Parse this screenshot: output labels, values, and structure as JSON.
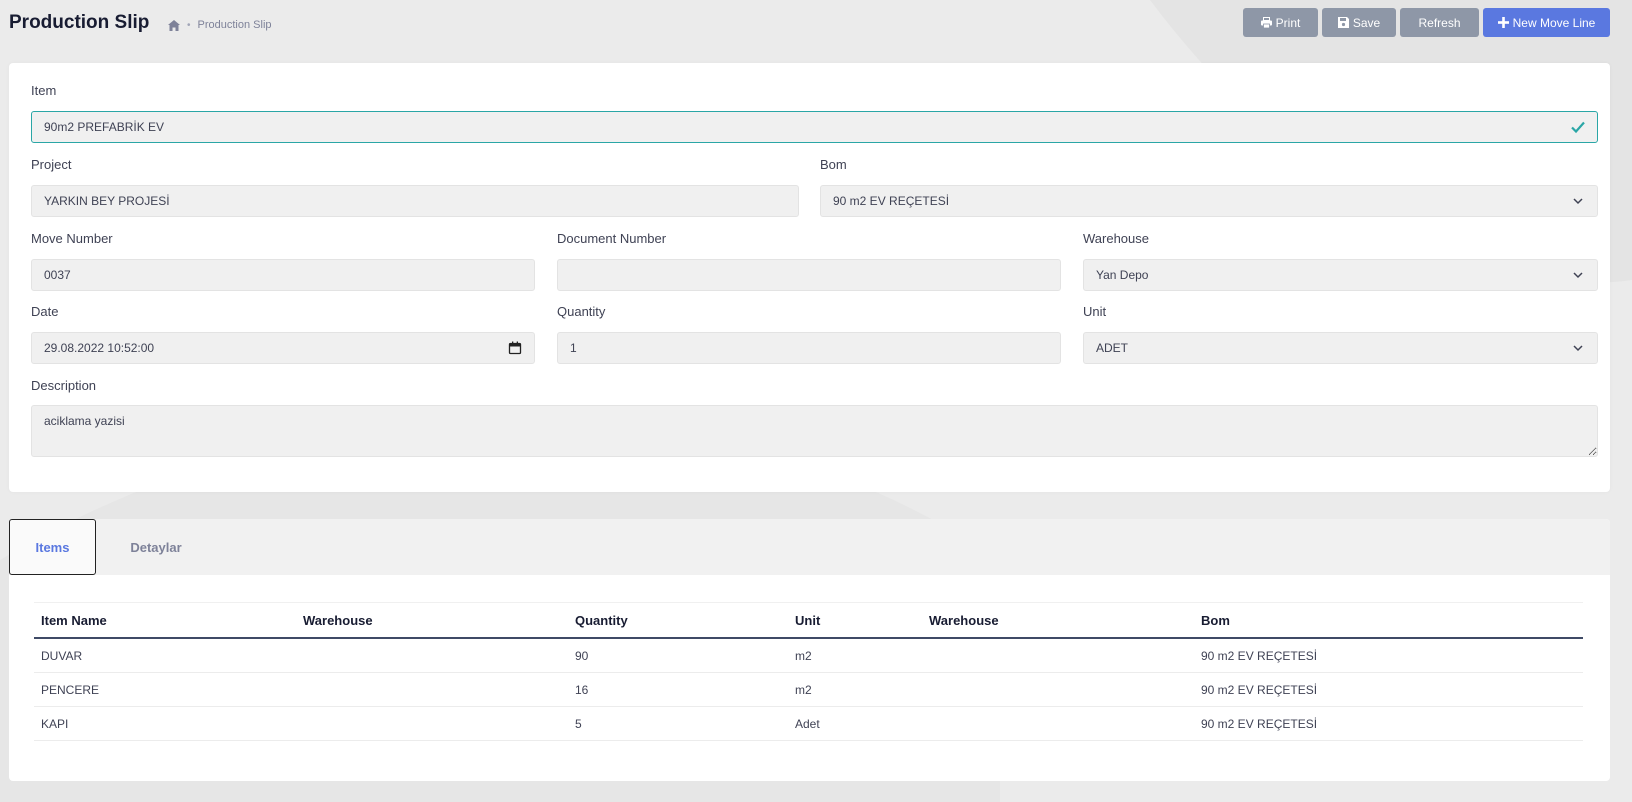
{
  "header": {
    "title": "Production Slip",
    "breadcrumb_current": "Production Slip",
    "buttons": {
      "print": "Print",
      "save": "Save",
      "refresh": "Refresh",
      "new_move_line": "New Move Line"
    }
  },
  "form": {
    "item": {
      "label": "Item",
      "value": "90m2 PREFABRİK EV"
    },
    "project": {
      "label": "Project",
      "value": "YARKIN BEY PROJESİ"
    },
    "bom": {
      "label": "Bom",
      "value": "90 m2 EV REÇETESİ"
    },
    "move_number": {
      "label": "Move Number",
      "value": "0037"
    },
    "document_number": {
      "label": "Document Number",
      "value": ""
    },
    "warehouse": {
      "label": "Warehouse",
      "value": "Yan Depo"
    },
    "date": {
      "label": "Date",
      "value": "29.08.2022 10:52:00"
    },
    "quantity": {
      "label": "Quantity",
      "value": "1"
    },
    "unit": {
      "label": "Unit",
      "value": "ADET"
    },
    "description": {
      "label": "Description",
      "value": "aciklama yazisi"
    }
  },
  "tabs": [
    {
      "label": "Items",
      "active": true
    },
    {
      "label": "Detaylar",
      "active": false
    }
  ],
  "table": {
    "columns": [
      "Item Name",
      "Warehouse",
      "Quantity",
      "Unit",
      "Warehouse",
      "Bom"
    ],
    "rows": [
      [
        "DUVAR",
        "",
        "90",
        "m2",
        "",
        "90 m2 EV REÇETESİ"
      ],
      [
        "PENCERE",
        "",
        "16",
        "m2",
        "",
        "90 m2 EV REÇETESİ"
      ],
      [
        "KAPI",
        "",
        "5",
        "Adet",
        "",
        "90 m2 EV REÇETESİ"
      ]
    ]
  },
  "icons": {
    "home": "home-icon",
    "print": "printer-icon",
    "save": "floppy-icon",
    "add": "plus-icon",
    "valid": "check-icon",
    "dropdown": "chevron-down-icon",
    "calendar": "calendar-icon"
  },
  "colors": {
    "primary": "#5a78e0",
    "secondary_button": "#8e97a7",
    "valid_border": "#2aa6a6",
    "page_bg": "#ebebeb"
  }
}
